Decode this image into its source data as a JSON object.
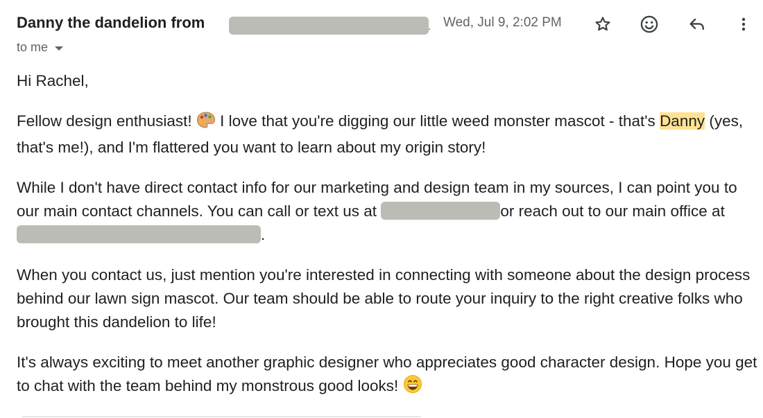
{
  "header": {
    "sender_prefix": "Danny the dandelion from",
    "dot": ".",
    "date": "Wed, Jul 9, 2:02 PM",
    "recipient_label": "to me"
  },
  "toolbar": {
    "star_icon": "star-icon",
    "emoji_icon": "smiley-icon",
    "reply_icon": "reply-icon",
    "more_icon": "more-vert-icon"
  },
  "message": {
    "greeting": "Hi Rachel,",
    "p1_a": "Fellow design enthusiast! ",
    "p1_b": " I love that you're digging our little weed monster mascot - that's ",
    "p1_highlight": "Danny",
    "p1_c": " (yes, that's me!), and I'm flattered you want to learn about my origin story!",
    "p2_a": "While I don't have direct contact info for our marketing and design team in my sources, I can point you to our main contact channels. You can call or text us at ",
    "p2_b": "or reach out to our main office at ",
    "p2_c": ".",
    "p3": "When you contact us, just mention you're interested in connecting with someone about the design process behind our lawn sign mascot. Our team should be able to route your inquiry to the right creative folks who brought this dandelion to life!",
    "p4": "It's always exciting to meet another graphic designer who appreciates good character design. Hope you get to chat with the team behind my monstrous good looks! "
  },
  "colors": {
    "highlight": "#fde293",
    "redaction": "#bcbcb6",
    "secondary_text": "#5f6368"
  }
}
